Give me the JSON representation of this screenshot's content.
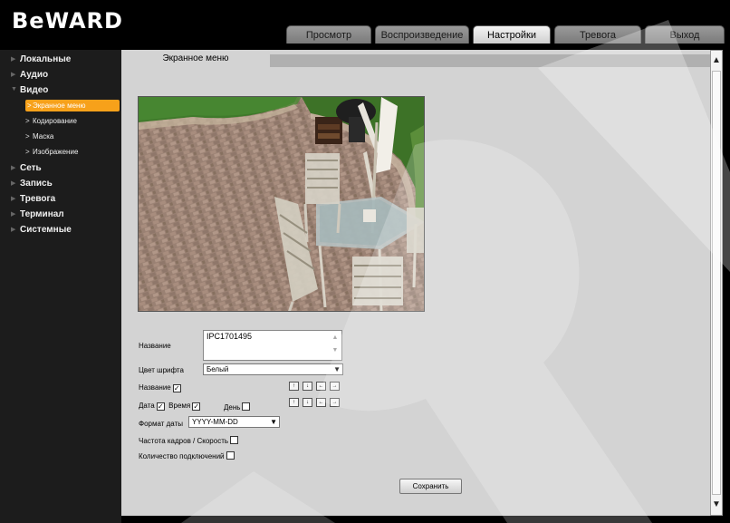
{
  "header": {
    "logo": "BeWARD"
  },
  "tabs": [
    {
      "label": "Просмотр"
    },
    {
      "label": "Воспроизведение"
    },
    {
      "label": "Настройки"
    },
    {
      "label": "Тревога"
    },
    {
      "label": "Выход"
    }
  ],
  "sidebar": {
    "items": [
      {
        "label": "Локальные",
        "arrow": "▶"
      },
      {
        "label": "Аудио",
        "arrow": "▶"
      },
      {
        "label": "Видео",
        "arrow": "▼"
      },
      {
        "label": "Сеть",
        "arrow": "▶"
      },
      {
        "label": "Запись",
        "arrow": "▶"
      },
      {
        "label": "Тревога",
        "arrow": "▶"
      },
      {
        "label": "Терминал",
        "arrow": "▶"
      },
      {
        "label": "Системные",
        "arrow": "▶"
      }
    ],
    "video_sub": [
      {
        "label": "Экранное меню",
        "arrow": ">"
      },
      {
        "label": "Кодирование",
        "arrow": ">"
      },
      {
        "label": "Маска",
        "arrow": ">"
      },
      {
        "label": "Изображение",
        "arrow": ">"
      }
    ]
  },
  "content": {
    "tab_label": "Экранное меню"
  },
  "form": {
    "name_label": "Название",
    "name_value": "IPC1701495",
    "font_color_label": "Цвет шрифта",
    "font_color_value": "Белый",
    "show_name_label": "Название",
    "date_label": "Дата",
    "time_label": "Время",
    "day_label": "День",
    "date_format_label": "Формат даты",
    "date_format_value": "YYYY-MM-DD",
    "fps_label": "Частота кадров / Скорость",
    "connections_label": "Количество подключений",
    "check_mark": "✓",
    "save_label": "Сохранить",
    "pos_up": "↑",
    "pos_down": "↓",
    "pos_left": "←",
    "pos_right": "→"
  },
  "checkbox_states": {
    "show_name": true,
    "date": true,
    "time": true,
    "day": false,
    "fps": false,
    "connections": false
  },
  "colors": {
    "accent": "#f7a11a",
    "panel": "#d3d3d3",
    "sidebar": "#1c1c1c"
  },
  "icons": {
    "scroll_up": "▲",
    "scroll_down": "▼",
    "select_caret": "▼",
    "textarea_up": "▲",
    "textarea_down": "▼"
  }
}
